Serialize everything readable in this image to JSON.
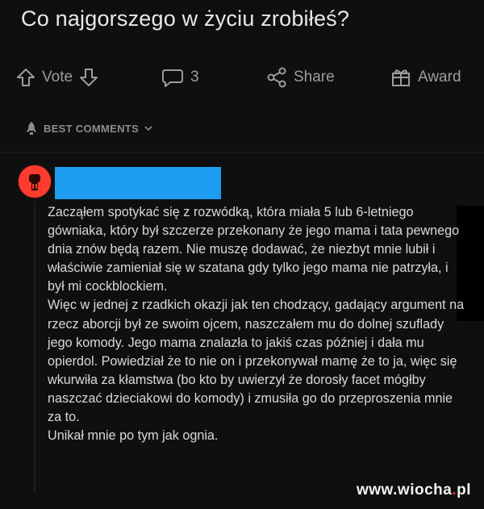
{
  "post": {
    "title": "Co najgorszego w życiu zrobiłeś?"
  },
  "actions": {
    "vote_label": "Vote",
    "comment_count": "3",
    "share_label": "Share",
    "award_label": "Award"
  },
  "sort": {
    "label": "BEST COMMENTS"
  },
  "comment": {
    "paragraphs": [
      "Zacząłem spotykać się z rozwódką, która miała 5 lub 6-letniego gówniaka, który był szczerze przekonany że jego mama i tata pewnego dnia znów będą razem. Nie muszę dodawać, że niezbyt mnie lubił i właściwie zamieniał się w szatana gdy tylko jego mama nie patrzyła, i był mi cockblockiem.",
      "Więc w jednej z rzadkich okazji jak ten chodzący, gadający argument na rzecz aborcji był ze swoim ojcem, naszczałem mu do dolnej szuflady jego komody. Jego mama znalazła to jakiś czas później i dała mu opierdol. Powiedział że to nie on i przekonywał mamę że to ja, więc się wkurwiła za kłamstwa (bo kto by uwierzył że dorosły facet mógłby naszczać dzieciakowi do komody) i zmusiła go do przeproszenia mnie za to.",
      "Unikał mnie po tym jak ognia."
    ]
  },
  "watermark": {
    "prefix": "www.",
    "name": "wiocha",
    "dot": ".",
    "tld": "pl"
  },
  "colors": {
    "background": "#0f0f10",
    "name_redaction": "#1e9cf0",
    "avatar": "#ff3b2f",
    "watermark_dot": "#e8372b"
  },
  "icons": [
    "arrow-up-icon",
    "arrow-down-icon",
    "comment-bubble-icon",
    "share-icon",
    "gift-icon",
    "rocket-icon",
    "chevron-down-icon"
  ]
}
